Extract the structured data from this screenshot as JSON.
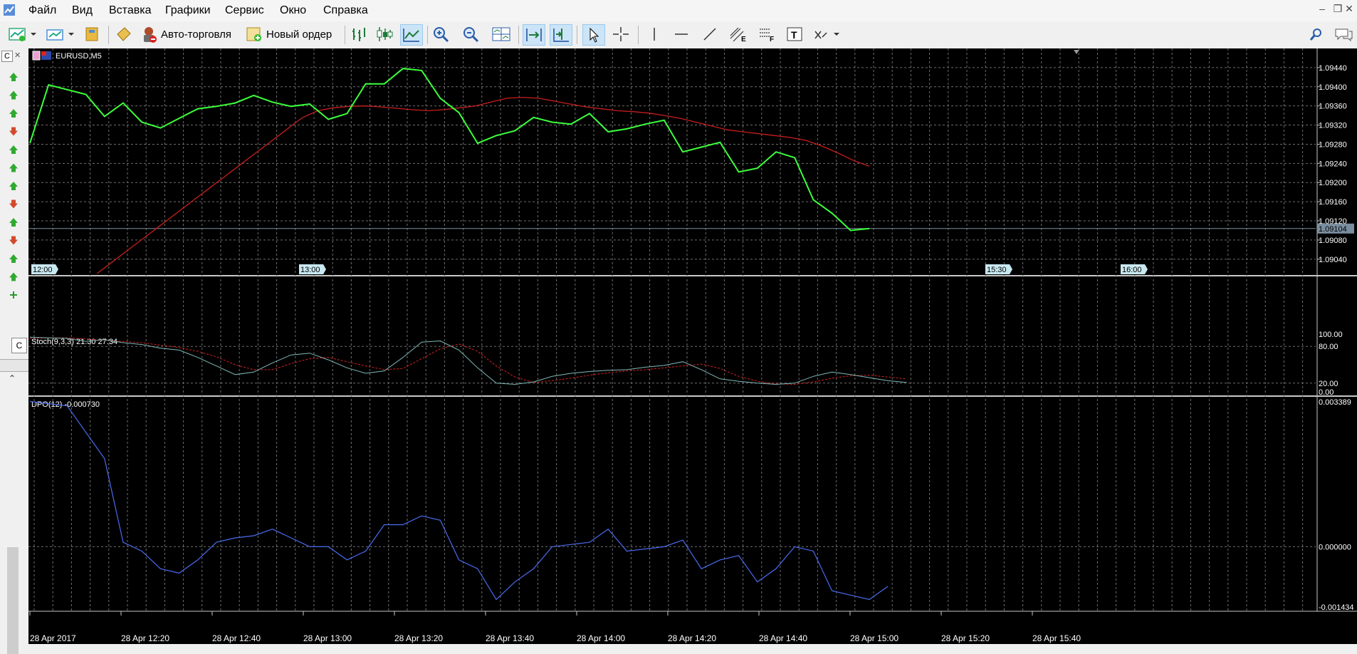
{
  "menu": [
    "Файл",
    "Вид",
    "Вставка",
    "Графики",
    "Сервис",
    "Окно",
    "Справка"
  ],
  "toolbar": {
    "autotrade_label": "Авто-торговля",
    "neworder_label": "Новый ордер"
  },
  "left_panel": {
    "tab_top": "C",
    "tab_mid": "C",
    "signals": [
      "up",
      "up",
      "up",
      "down",
      "up",
      "up",
      "up",
      "down",
      "up",
      "down",
      "up",
      "up",
      "add"
    ]
  },
  "main_chart": {
    "symbol_label": "EURUSD,M5",
    "price_ticks": [
      "1.09440",
      "1.09400",
      "1.09360",
      "1.09320",
      "1.09280",
      "1.09240",
      "1.09200",
      "1.09160",
      "1.09120",
      "1.09080",
      "1.09040"
    ],
    "current_price": "1.09104",
    "price_range": [
      1.0901,
      1.09474
    ],
    "time_markers": [
      "12:00",
      "13:00",
      "15:30",
      "16:00"
    ],
    "close": [
      1.09282,
      1.09404,
      1.09394,
      1.09384,
      1.09338,
      1.09366,
      1.09326,
      1.09314,
      1.09334,
      1.09354,
      1.09359,
      1.09366,
      1.09382,
      1.09368,
      1.09359,
      1.09364,
      1.09332,
      1.09344,
      1.09406,
      1.09406,
      1.09438,
      1.09434,
      1.09376,
      1.09346,
      1.09282,
      1.09298,
      1.09308,
      1.09336,
      1.09326,
      1.09322,
      1.09344,
      1.09306,
      1.09312,
      1.09322,
      1.0933,
      1.09264,
      1.09274,
      1.09284,
      1.09222,
      1.0923,
      1.09264,
      1.09252,
      1.09164,
      1.09136,
      1.091,
      1.09104
    ],
    "ma": [
      null,
      null,
      1.0901,
      1.09035,
      1.0906,
      1.09085,
      1.0911,
      1.09135,
      1.0916,
      1.09185,
      1.0921,
      1.09235,
      1.0926,
      1.09285,
      1.0931,
      1.09335,
      1.0935,
      1.09356,
      1.09359,
      1.0936,
      1.09358,
      1.09355,
      1.09352,
      1.0935,
      1.09352,
      1.09356,
      1.0936,
      1.09368,
      1.09376,
      1.09378,
      1.09376,
      1.0937,
      1.09364,
      1.09358,
      1.09354,
      1.0935,
      1.09348,
      1.09345,
      1.0934,
      1.09334,
      1.09326,
      1.09318,
      1.0931,
      1.09306,
      1.09302,
      1.09298,
      1.09294,
      1.09288,
      1.09276,
      1.09262,
      1.09246,
      1.09234
    ]
  },
  "stoch": {
    "label": "Stoch(9,3,3) 21.30 27.34",
    "ticks": [
      "100.00",
      "80.00",
      "20.00",
      "0.00"
    ],
    "main": [
      95,
      94,
      93,
      88,
      91,
      86,
      83,
      77,
      74,
      62,
      48,
      34,
      38,
      53,
      66,
      69,
      58,
      45,
      36,
      40,
      62,
      87,
      89,
      74,
      45,
      20,
      18,
      22,
      31,
      36,
      39,
      41,
      42,
      46,
      49,
      55,
      42,
      27,
      23,
      20,
      18,
      20,
      31,
      38,
      34,
      29,
      24,
      21
    ],
    "signal": [
      93,
      94,
      94,
      92,
      90,
      88,
      86,
      82,
      78,
      72,
      63,
      50,
      42,
      42,
      52,
      60,
      62,
      55,
      48,
      42,
      44,
      60,
      76,
      84,
      72,
      48,
      30,
      21,
      24,
      28,
      33,
      37,
      40,
      42,
      45,
      48,
      51,
      44,
      31,
      23,
      19,
      18,
      22,
      28,
      32,
      33,
      30,
      27
    ]
  },
  "dpo": {
    "label": "DPO(12) -0.000730",
    "ticks": [
      "0.003389",
      "0.000000",
      "-0.001434"
    ],
    "range": [
      -0.001434,
      0.003389
    ],
    "values": [
      0.0033,
      0.00325,
      0.0032,
      0.0026,
      0.002,
      0.0001,
      -0.0001,
      -0.0005,
      -0.0006,
      -0.0003,
      0.0001,
      0.0002,
      0.00025,
      0.0004,
      0.0002,
      0.0,
      0.0,
      -0.0003,
      -0.0001,
      0.0005,
      0.0005,
      0.0007,
      0.0006,
      -0.0003,
      -0.0005,
      -0.0012,
      -0.0008,
      -0.0005,
      0.0,
      5e-05,
      0.0001,
      0.0004,
      -0.0001,
      -5e-05,
      0.0,
      0.00015,
      -0.0005,
      -0.0003,
      -0.0002,
      -0.0008,
      -0.0005,
      0.0,
      -0.0001,
      -0.001,
      -0.0011,
      -0.0012,
      -0.0009
    ]
  },
  "time_axis": [
    "28 Apr 2017",
    "28 Apr 12:20",
    "28 Apr 12:40",
    "28 Apr 13:00",
    "28 Apr 13:20",
    "28 Apr 13:40",
    "28 Apr 14:00",
    "28 Apr 14:20",
    "28 Apr 14:40",
    "28 Apr 15:00",
    "28 Apr 15:20",
    "28 Apr 15:40"
  ],
  "colors": {
    "price_line": "#3cff3c",
    "ma_line": "#c81e1e",
    "stoch_main": "#7fb8b8",
    "stoch_signal": "#d22222",
    "dpo_line": "#4a6cf0",
    "grid": "#6e6e6e",
    "background": "#000000"
  }
}
